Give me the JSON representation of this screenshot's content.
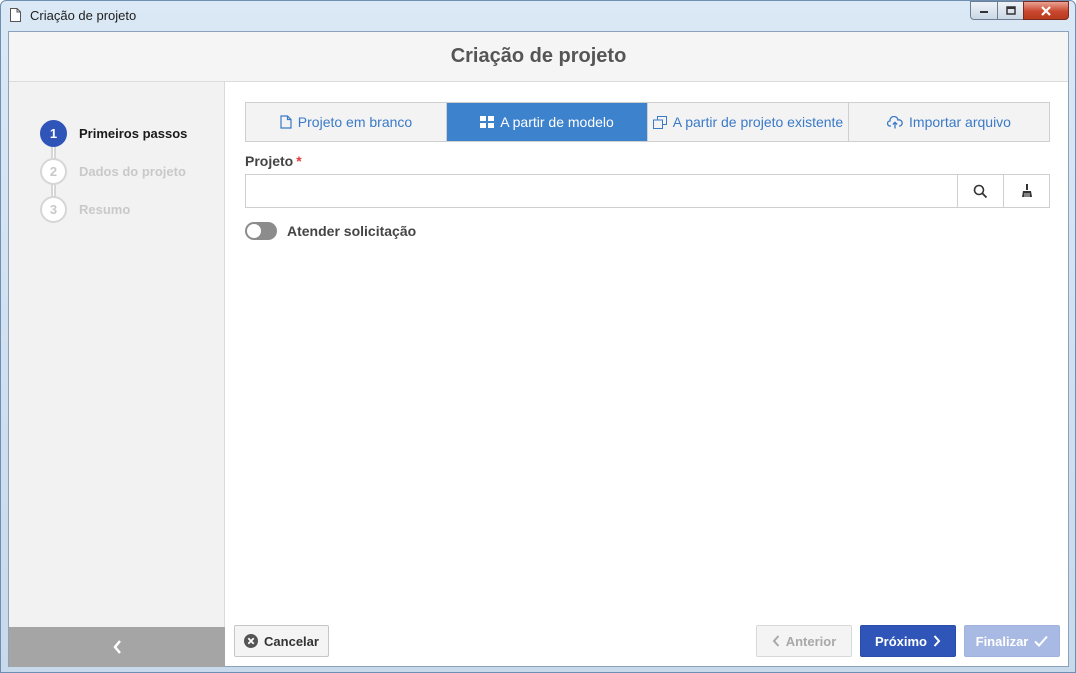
{
  "window": {
    "title": "Criação de projeto"
  },
  "header": {
    "title": "Criação de projeto"
  },
  "steps": [
    {
      "number": "1",
      "label": "Primeiros passos",
      "active": true
    },
    {
      "number": "2",
      "label": "Dados do projeto",
      "active": false
    },
    {
      "number": "3",
      "label": "Resumo",
      "active": false
    }
  ],
  "tabs": [
    {
      "label": "Projeto em branco",
      "icon": "document-icon",
      "selected": false
    },
    {
      "label": "A partir de modelo",
      "icon": "grid-icon",
      "selected": true
    },
    {
      "label": "A partir de projeto existente",
      "icon": "copy-icon",
      "selected": false
    },
    {
      "label": "Importar arquivo",
      "icon": "cloud-upload-icon",
      "selected": false
    }
  ],
  "form": {
    "project_label": "Projeto",
    "required_mark": "*",
    "project_value": "",
    "toggle_label": "Atender solicitação",
    "toggle_on": false
  },
  "footer": {
    "cancel": "Cancelar",
    "previous": "Anterior",
    "next": "Próximo",
    "finish": "Finalizar"
  },
  "colors": {
    "primary": "#2f55b9",
    "tab_selected": "#3d82cc",
    "tab_text": "#3a7ac7",
    "required": "#e03b3b"
  }
}
